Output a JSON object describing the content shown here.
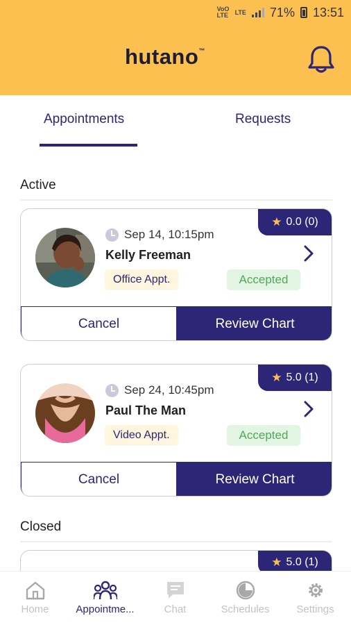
{
  "status_bar": {
    "volte": "VoO LTE",
    "lte": "LTE",
    "battery": "71%",
    "time": "13:51"
  },
  "header": {
    "logo_text": "hutano",
    "logo_tm": "™",
    "bell_icon": "bell-icon"
  },
  "tabs": [
    {
      "label": "Appointments",
      "active": true
    },
    {
      "label": "Requests",
      "active": false
    }
  ],
  "sections": {
    "active_label": "Active",
    "closed_label": "Closed"
  },
  "appointments": [
    {
      "rating": "0.0 (0)",
      "datetime": "Sep 14, 10:15pm",
      "name": "Kelly Freeman",
      "type": "Office Appt.",
      "status": "Accepted",
      "cancel_label": "Cancel",
      "review_label": "Review Chart"
    },
    {
      "rating": "5.0 (1)",
      "datetime": "Sep 24, 10:45pm",
      "name": "Paul The Man",
      "type": "Video Appt.",
      "status": "Accepted",
      "cancel_label": "Cancel",
      "review_label": "Review Chart"
    }
  ],
  "closed": [
    {
      "rating": "5.0 (1)"
    }
  ],
  "nav": [
    {
      "label": "Home",
      "icon": "home-icon"
    },
    {
      "label": "Appointme...",
      "icon": "people-icon"
    },
    {
      "label": "Chat",
      "icon": "chat-icon"
    },
    {
      "label": "Schedules",
      "icon": "schedule-icon"
    },
    {
      "label": "Settings",
      "icon": "gear-icon"
    }
  ],
  "colors": {
    "brand_yellow": "#fcc051",
    "brand_purple": "#2d2575",
    "accepted_green": "#4aab58"
  }
}
